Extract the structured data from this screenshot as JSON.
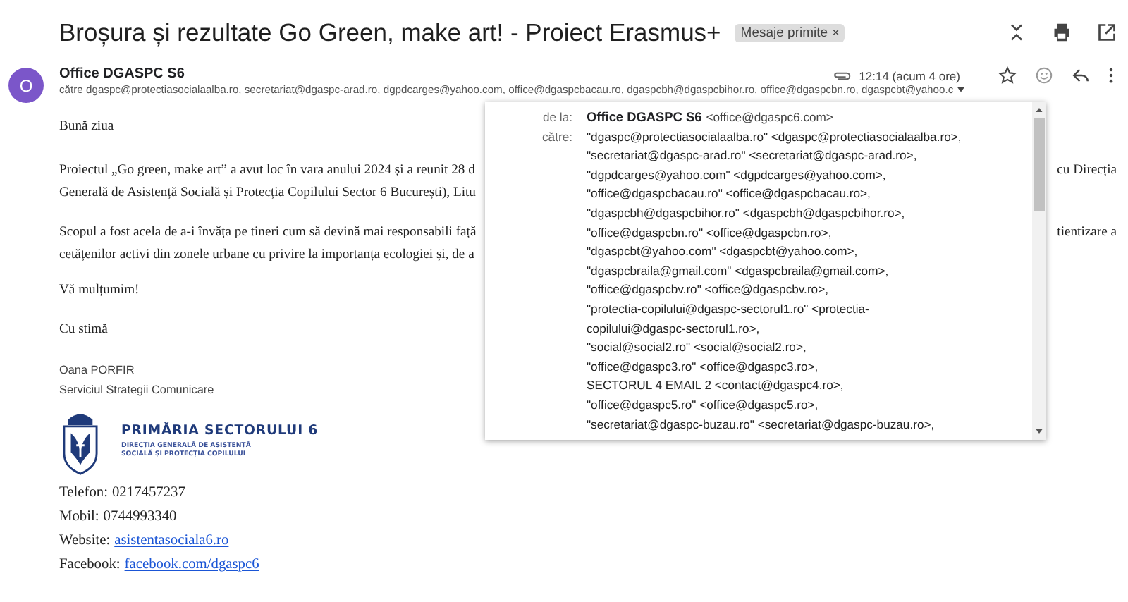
{
  "subject": "Broșura și rezultate Go Green, make art! - Proiect Erasmus+",
  "label_chip": {
    "text": "Mesaje primite",
    "close": "×"
  },
  "sender": {
    "avatar": "O",
    "name": "Office DGASPC S6",
    "to": "către dgaspc@protectiasocialaalba.ro, secretariat@dgaspc-arad.ro, dgpdcarges@yahoo.com, office@dgaspcbacau.ro, dgaspcbh@dgaspcbihor.ro, office@dgaspcbn.ro, dgaspcbt@yahoo.c",
    "time": "12:14 (acum 4 ore)"
  },
  "body": {
    "greeting": "Bună ziua",
    "paragraphs": [
      {
        "lines": [
          {
            "left": "Proiectul „Go green, make art” a avut loc în vara anului 2024 și a reunit 28 d",
            "right": "cu Direcția"
          },
          {
            "left": "Generală de Asistență Socială și Protecția Copilului Sector 6 București), Litu"
          }
        ]
      },
      {
        "lines": [
          {
            "left": "Scopul a fost acela de a-i învăța pe tineri cum să devină mai responsabili față",
            "right": "tientizare a"
          },
          {
            "left": "cetățenilor activi din zonele urbane cu privire la importanța ecologiei și, de a"
          }
        ]
      }
    ],
    "thanks": "Vă mulțumim!",
    "closing": "Cu stimă"
  },
  "signature": {
    "name": "Oana PORFIR",
    "department": "Serviciul Strategii Comunicare",
    "logo": {
      "title": "PRIMĂRIA SECTORULUI 6",
      "subtitle_lines": [
        "DIRECȚIA GENERALĂ DE ASISTENȚĂ",
        "SOCIALĂ ȘI PROTECȚIA COPILULUI"
      ]
    },
    "contacts": [
      {
        "label": "Telefon:",
        "value": "0217457237",
        "kind": "text"
      },
      {
        "label": "Mobil:",
        "value": "0744993340",
        "kind": "text"
      },
      {
        "label": "Website:",
        "value": "asistentasociala6.ro",
        "kind": "link"
      },
      {
        "label": "Facebook:",
        "value": "facebook.com/dgaspc6",
        "kind": "link"
      }
    ]
  },
  "details_popup": {
    "from_label": "de la:",
    "from_name": "Office DGASPC S6",
    "from_email": "<office@dgaspc6.com>",
    "to_label": "către:",
    "recipients": [
      "\"dgaspc@protectiasocialaalba.ro\" <dgaspc@protectiasocialaalba.ro>,",
      "\"secretariat@dgaspc-arad.ro\" <secretariat@dgaspc-arad.ro>,",
      "\"dgpdcarges@yahoo.com\" <dgpdcarges@yahoo.com>,",
      "\"office@dgaspcbacau.ro\" <office@dgaspcbacau.ro>,",
      "\"dgaspcbh@dgaspcbihor.ro\" <dgaspcbh@dgaspcbihor.ro>,",
      "\"office@dgaspcbn.ro\" <office@dgaspcbn.ro>,",
      "\"dgaspcbt@yahoo.com\" <dgaspcbt@yahoo.com>,",
      "\"dgaspcbraila@gmail.com\" <dgaspcbraila@gmail.com>,",
      "\"office@dgaspcbv.ro\" <office@dgaspcbv.ro>,",
      "\"protectia-copilului@dgaspc-sectorul1.ro\" <protectia-",
      "copilului@dgaspc-sectorul1.ro>,",
      "\"social@social2.ro\" <social@social2.ro>,",
      "\"office@dgaspc3.ro\" <office@dgaspc3.ro>,",
      "SECTORUL 4 EMAIL 2 <contact@dgaspc4.ro>,",
      "\"office@dgaspc5.ro\" <office@dgaspc5.ro>,",
      "\"secretariat@dgaspc-buzau.ro\" <secretariat@dgaspc-buzau.ro>,"
    ]
  }
}
